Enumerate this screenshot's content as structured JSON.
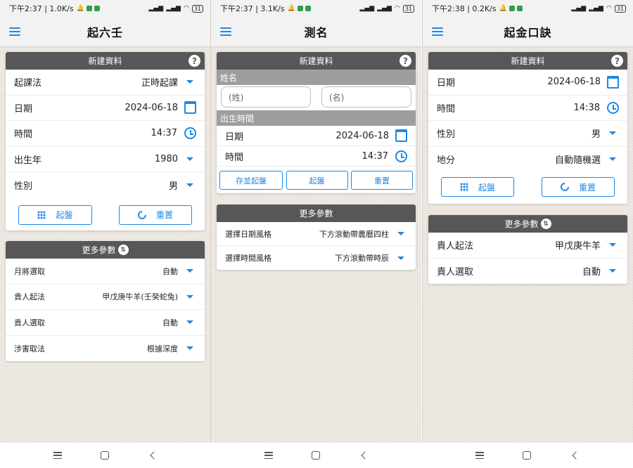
{
  "colors": {
    "accent": "#1e88e5",
    "card_header": "#575757",
    "section_header": "#9e9e9e",
    "background": "#ede9e2"
  },
  "screens": [
    {
      "status": {
        "time": "下午2:37",
        "speed": "1.0K/s",
        "battery": "31"
      },
      "title": "起六壬",
      "card_title": "新建資料",
      "rows": [
        {
          "label": "起課法",
          "value": "正時起課",
          "control": "dropdown"
        },
        {
          "label": "日期",
          "value": "2024-06-18",
          "control": "calendar-icon"
        },
        {
          "label": "時間",
          "value": "14:37",
          "control": "clock-icon"
        },
        {
          "label": "出生年",
          "value": "1980",
          "control": "dropdown"
        },
        {
          "label": "性別",
          "value": "男",
          "control": "dropdown"
        }
      ],
      "buttons": {
        "start": "起盤",
        "reset": "重置"
      },
      "more_title": "更多參數",
      "more_rows": [
        {
          "label": "月將選取",
          "value": "自動"
        },
        {
          "label": "貴人起法",
          "value": "甲戊庚牛羊(壬癸蛇兔)"
        },
        {
          "label": "貴人選取",
          "value": "自動"
        },
        {
          "label": "涉害取法",
          "value": "根據深度"
        }
      ]
    },
    {
      "status": {
        "time": "下午2:37",
        "speed": "3.1K/s",
        "battery": "31"
      },
      "title": "測名",
      "card_title": "新建資料",
      "name_section": "姓名",
      "surname_placeholder": "(姓)",
      "given_placeholder": "(名)",
      "birth_section": "出生時間",
      "rows": [
        {
          "label": "日期",
          "value": "2024-06-18",
          "control": "calendar-icon"
        },
        {
          "label": "時間",
          "value": "14:37",
          "control": "clock-icon"
        }
      ],
      "buttons": {
        "save": "存並起盤",
        "start": "起盤",
        "reset": "重置"
      },
      "more_title": "更多參數",
      "more_rows": [
        {
          "label": "選擇日期風格",
          "value": "下方滾動帶農曆四柱"
        },
        {
          "label": "選擇時間風格",
          "value": "下方滾動帶時辰"
        }
      ]
    },
    {
      "status": {
        "time": "下午2:38",
        "speed": "0.2K/s",
        "battery": "31"
      },
      "title": "起金口訣",
      "card_title": "新建資料",
      "rows": [
        {
          "label": "日期",
          "value": "2024-06-18",
          "control": "calendar-icon"
        },
        {
          "label": "時間",
          "value": "14:38",
          "control": "clock-icon"
        },
        {
          "label": "性別",
          "value": "男",
          "control": "dropdown"
        },
        {
          "label": "地分",
          "value": "自動隨機選",
          "control": "dropdown"
        }
      ],
      "buttons": {
        "start": "起盤",
        "reset": "重置"
      },
      "more_title": "更多參數",
      "more_rows": [
        {
          "label": "貴人起法",
          "value": "甲戊庚牛羊"
        },
        {
          "label": "貴人選取",
          "value": "自動"
        }
      ]
    }
  ],
  "nav": {
    "menu": "menu-icon",
    "home": "home-icon",
    "back": "back-icon"
  }
}
